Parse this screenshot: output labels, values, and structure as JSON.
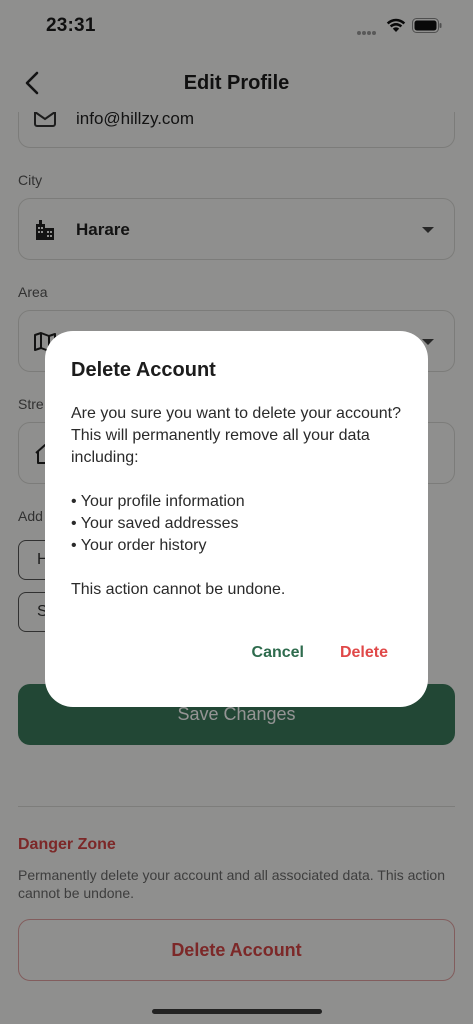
{
  "status_bar": {
    "time": "23:31"
  },
  "header": {
    "title": "Edit Profile"
  },
  "form": {
    "email": {
      "value": "info@hillzy.com"
    },
    "city": {
      "label": "City",
      "value": "Harare"
    },
    "area": {
      "label": "Area",
      "value": ""
    },
    "street": {
      "label": "Stre",
      "value": ""
    },
    "address_label": "Add",
    "chips": [
      "H",
      "S"
    ],
    "save_label": "Save Changes"
  },
  "danger_zone": {
    "title": "Danger Zone",
    "description": "Permanently delete your account and all associated data. This action cannot be undone.",
    "delete_label": "Delete Account"
  },
  "dialog": {
    "title": "Delete Account",
    "intro": "Are you sure you want to delete your account? This will permanently remove all your data including:",
    "items": [
      "• Your profile information",
      "• Your saved addresses",
      "• Your order history"
    ],
    "warning": "This action cannot be undone.",
    "cancel_label": "Cancel",
    "delete_label": "Delete"
  },
  "colors": {
    "accent": "#3b7a5c",
    "danger": "#d64545",
    "cancel_text": "#2e6b4d"
  }
}
